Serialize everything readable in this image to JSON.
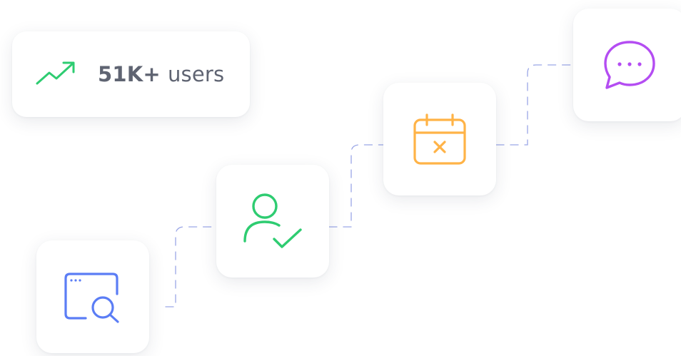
{
  "stat": {
    "icon": "trending-up-icon",
    "value": "51K+",
    "unit": "users",
    "accent": "#2ecc71"
  },
  "steps": [
    {
      "icon": "browser-search-icon",
      "color": "#5b7df5"
    },
    {
      "icon": "user-check-icon",
      "color": "#2ecc71"
    },
    {
      "icon": "calendar-cancel-icon",
      "color": "#ffb347"
    },
    {
      "icon": "chat-bubble-icon",
      "color": "#b44df2"
    }
  ],
  "connector_color": "#9aa6e6"
}
